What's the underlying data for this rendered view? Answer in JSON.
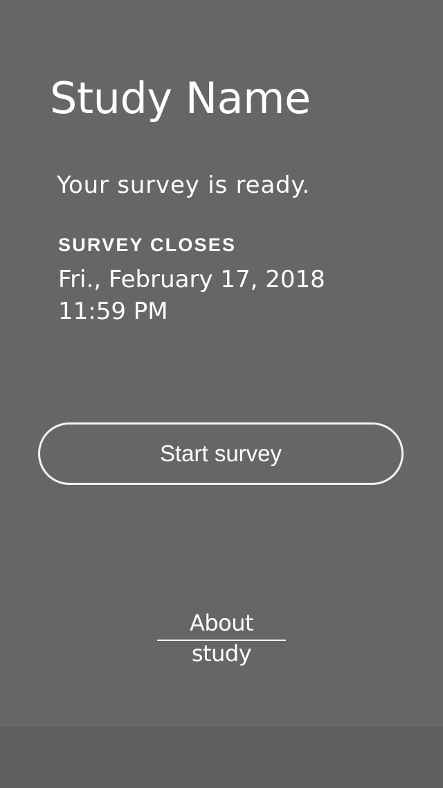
{
  "study": {
    "name": "Study Name"
  },
  "survey": {
    "status_text": "Your survey is ready.",
    "closes_label": "SURVEY CLOSES",
    "closes_date": "Fri., February 17, 2018",
    "closes_time": "11:59 PM"
  },
  "actions": {
    "start_label": "Start survey",
    "about_label": "About study"
  },
  "colors": {
    "background": "#666666",
    "footer": "#5e5e5e",
    "text": "#ffffff",
    "button_border": "#f2f2f2"
  }
}
